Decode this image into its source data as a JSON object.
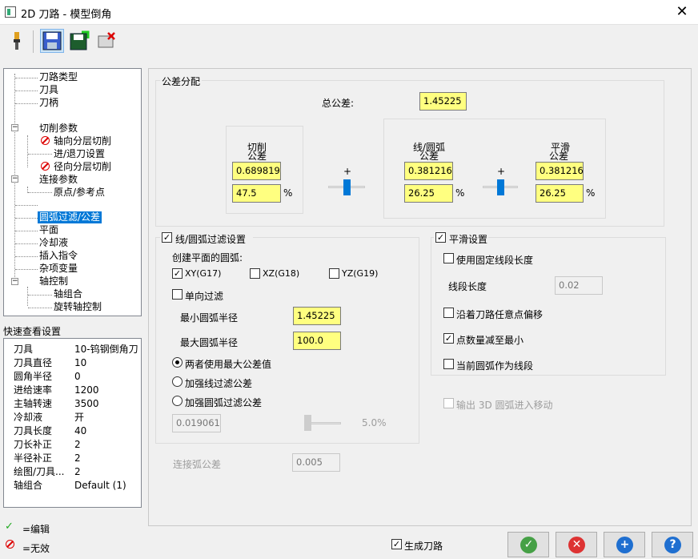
{
  "window": {
    "title": "2D 刀路 - 模型倒角"
  },
  "tree": {
    "items": [
      {
        "label": "刀路类型"
      },
      {
        "label": "刀具"
      },
      {
        "label": "刀柄"
      },
      {
        "label": "切削参数"
      },
      {
        "label": "轴向分层切削"
      },
      {
        "label": "进/退刀设置"
      },
      {
        "label": "径向分层切削"
      },
      {
        "label": "连接参数"
      },
      {
        "label": "原点/参考点"
      },
      {
        "label": "圆弧过滤/公差"
      },
      {
        "label": "平面"
      },
      {
        "label": "冷却液"
      },
      {
        "label": "插入指令"
      },
      {
        "label": "杂项变量"
      },
      {
        "label": "轴控制"
      },
      {
        "label": "轴组合"
      },
      {
        "label": "旋转轴控制"
      }
    ]
  },
  "quick_settings": {
    "title": "快速查看设置",
    "rows": [
      {
        "key": "刀具",
        "value": "10-钨钢倒角刀"
      },
      {
        "key": "刀具直径",
        "value": "10"
      },
      {
        "key": "圆角半径",
        "value": "0"
      },
      {
        "key": "进给速率",
        "value": "1200"
      },
      {
        "key": "主轴转速",
        "value": "3500"
      },
      {
        "key": "冷却液",
        "value": "开"
      },
      {
        "key": "刀具长度",
        "value": "40"
      },
      {
        "key": "刀长补正",
        "value": "2"
      },
      {
        "key": "半径补正",
        "value": "2"
      },
      {
        "key": "绘图/刀具...",
        "value": "2"
      },
      {
        "key": "轴组合",
        "value": "Default (1)"
      }
    ]
  },
  "legend": {
    "edit": "=编辑",
    "invalid": "=无效"
  },
  "tolerance": {
    "group_title": "公差分配",
    "total_label": "总公差:",
    "total_value": "1.45225",
    "cut_label_1": "切削",
    "cut_label_2": "公差",
    "cut_value": "0.689819",
    "cut_pct": "47.5",
    "line_arc_label_1": "线/圆弧",
    "line_arc_label_2": "公差",
    "line_arc_value": "0.381216",
    "line_arc_pct": "26.25",
    "smooth_label_1": "平滑",
    "smooth_label_2": "公差",
    "smooth_value": "0.381216",
    "smooth_pct": "26.25",
    "pct_sign": "%",
    "plus": "+",
    "slider1_level": 0.5,
    "slider2_level": 0.5
  },
  "line_arc_filter": {
    "title": "线/圆弧过滤设置",
    "checked": true,
    "create_plane_label": "创建平面的圆弧:",
    "xy": "XY(G17)",
    "xz": "XZ(G18)",
    "yz": "YZ(G19)",
    "one_way": "单向过滤",
    "min_radius_label": "最小圆弧半径",
    "min_radius": "1.45225",
    "max_radius_label": "最大圆弧半径",
    "max_radius": "100.0",
    "radio_both": "两者使用最大公差值",
    "radio_line": "加强线过滤公差",
    "radio_arc": "加强圆弧过滤公差",
    "disabled_value": "0.019061",
    "disabled_pct": "5.0%",
    "connect_arc_label": "连接弧公差",
    "connect_arc_value": "0.005"
  },
  "smooth": {
    "title": "平滑设置",
    "checked": true,
    "fixed_seg": "使用固定线段长度",
    "seg_len_label": "线段长度",
    "seg_len_value": "0.02",
    "any_point": "沿着刀路任意点偏移",
    "min_points": "点数量减至最小",
    "current_arc": "当前圆弧作为线段",
    "output_3d": "输出 3D 圆弧进入移动"
  },
  "footer": {
    "generate": "生成刀路"
  }
}
